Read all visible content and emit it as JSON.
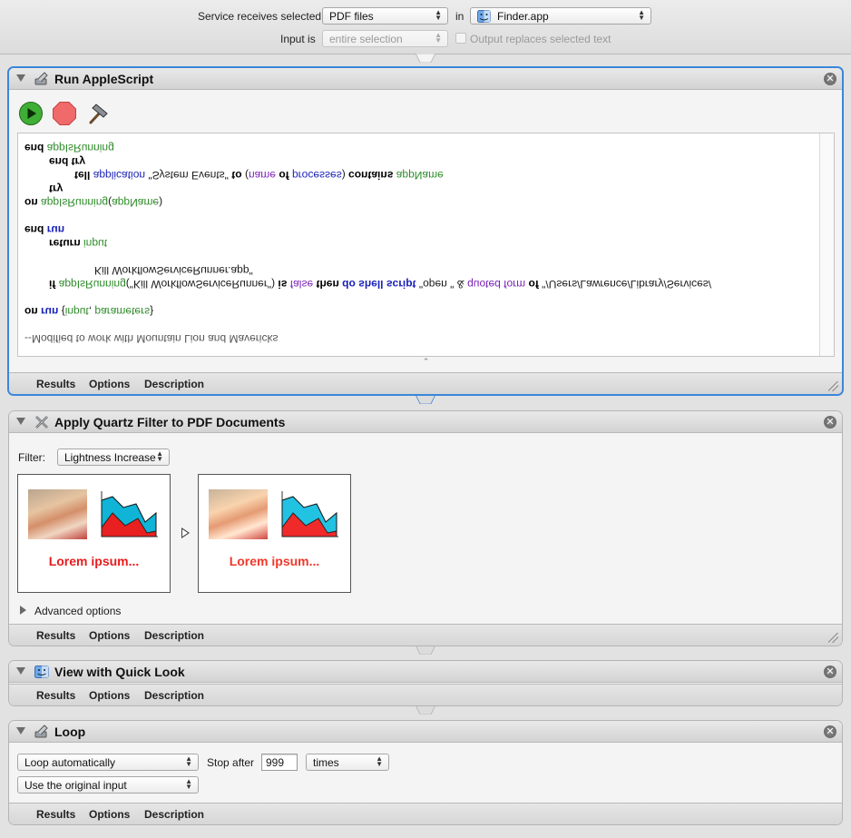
{
  "header": {
    "service_label": "Service receives selected",
    "service_value": "PDF files",
    "in_label": "in",
    "app_value": "Finder.app",
    "input_label": "Input is",
    "input_value": "entire selection",
    "replace_label": "Output replaces selected text"
  },
  "footer_tabs": {
    "results": "Results",
    "options": "Options",
    "description": "Description"
  },
  "applescript": {
    "title": "Run AppleScript",
    "close_glyph": "✕",
    "lines": [
      "--Modified to work with Mountain Lion and Mavericks",
      "on run {input, parameters}",
      "if appIsRunning(\"Kill WorkflowServiceRunner\") is false then do shell script \"open \" & quoted form of \"/Users/Lawrence/Library/Services/",
      "Kill WorkflowServiceRunner.app\"",
      "return input",
      "end run",
      "on appIsRunning(appName)",
      "try",
      "tell application \"System Events\" to (name of processes) contains appName",
      "end try",
      "end appIsRunning"
    ],
    "resize_glyph": "⌃"
  },
  "quartz": {
    "title": "Apply Quartz Filter to PDF Documents",
    "filter_label": "Filter:",
    "filter_value": "Lightness Increase",
    "before_text": "Lorem ipsum...",
    "after_text": "Lorem ipsum...",
    "advanced": "Advanced options"
  },
  "quicklook": {
    "title": "View with Quick Look"
  },
  "loop": {
    "title": "Loop",
    "mode_value": "Loop automatically",
    "stop_after_label": "Stop after",
    "count_value": "999",
    "unit_value": "times",
    "input_value": "Use the original input"
  },
  "colors": {
    "selection": "#3b86d9",
    "keyword_app": "#1a22b6",
    "variable": "#2d8a28",
    "property": "#7a22b8",
    "lorem_red": "#e71c1c"
  }
}
